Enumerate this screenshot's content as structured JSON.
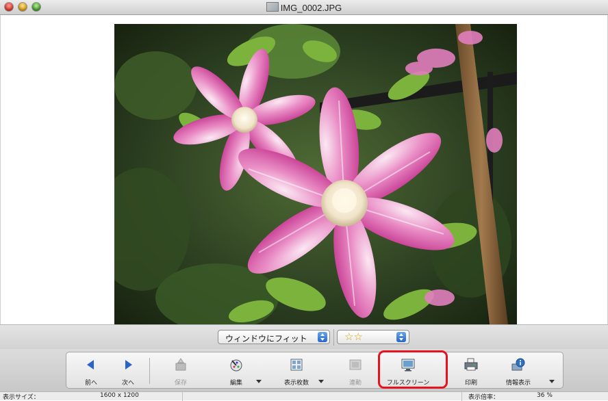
{
  "window": {
    "title": "IMG_0002.JPG",
    "title_icon": "image-file-icon"
  },
  "viewer": {
    "photo_icon": "clematis-flower-photo"
  },
  "fitbar": {
    "fit_mode": "ウィンドウにフィット",
    "rating": "☆☆"
  },
  "toolbar": {
    "prev": "前へ",
    "next": "次へ",
    "save": "保存",
    "edit": "編集",
    "display_count": "表示枚数",
    "sync": "連動",
    "fullscreen": "フルスクリーン",
    "print": "印刷",
    "info": "情報表示"
  },
  "status": {
    "size_label": "表示サイズ：",
    "size_value": "1600 x 1200",
    "zoom_label": "表示倍率：",
    "zoom_value": "36 %"
  },
  "colors": {
    "highlight": "#e8121d",
    "nav_arrow": "#2a64c8",
    "rating_star": "#d4a400"
  }
}
